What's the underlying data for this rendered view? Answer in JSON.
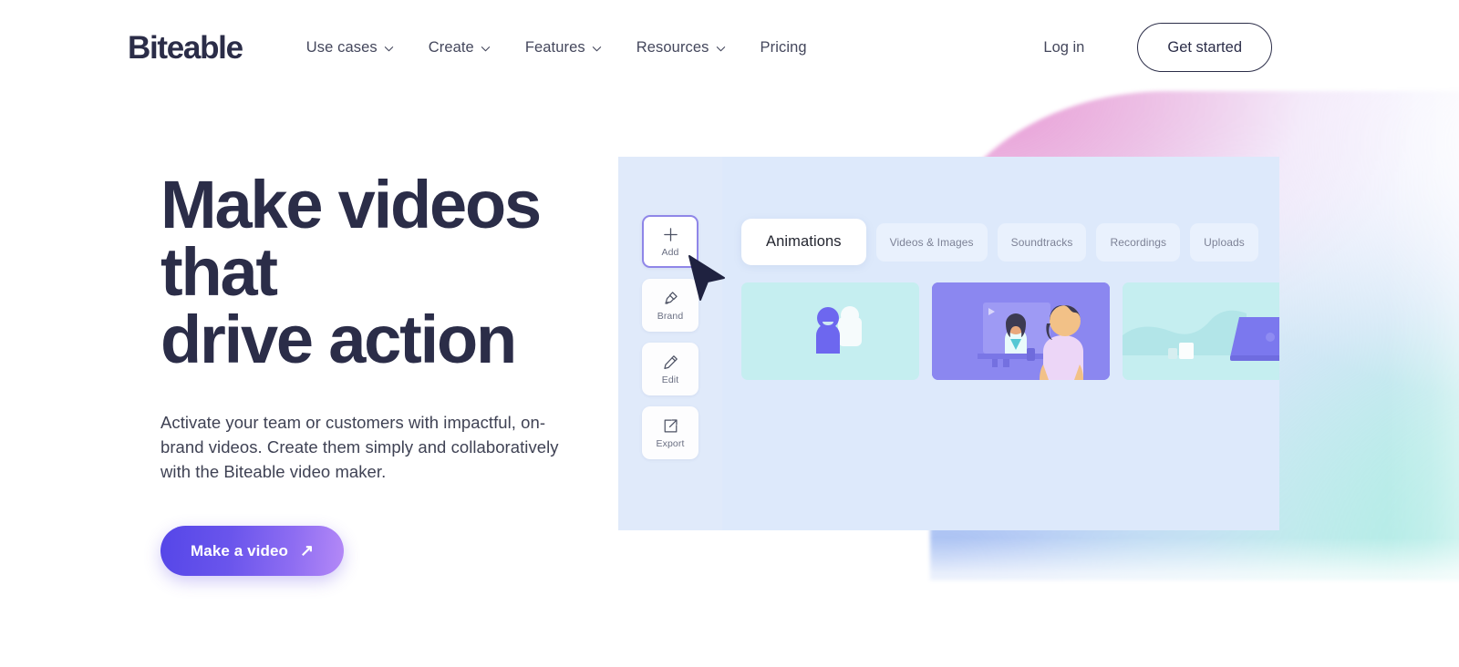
{
  "brand": {
    "logo_text": "Biteable",
    "accent_purple": "#5546e8",
    "accent_purple_light": "#b489f7",
    "text_dark": "#2b2d48"
  },
  "header": {
    "nav_items": [
      {
        "label": "Use cases",
        "has_chevron": true,
        "icon": "chevron-down-icon"
      },
      {
        "label": "Create",
        "has_chevron": true,
        "icon": "chevron-down-icon"
      },
      {
        "label": "Features",
        "has_chevron": true,
        "icon": "chevron-down-icon"
      },
      {
        "label": "Resources",
        "has_chevron": true,
        "icon": "chevron-down-icon"
      },
      {
        "label": "Pricing",
        "has_chevron": false,
        "icon": ""
      }
    ],
    "login_label": "Log in",
    "get_started_label": "Get started"
  },
  "hero": {
    "title": "Make videos that\ndrive action",
    "subtitle": "Activate your team or customers with impactful, on-brand videos. Create them simply and collaboratively with the Biteable video maker.",
    "cta_label": "Make a video",
    "cta_arrow": "↗"
  },
  "app_mock": {
    "sidebar_items": [
      {
        "label": "Add",
        "icon": "plus-icon",
        "active": true
      },
      {
        "label": "Brand",
        "icon": "paint-roller-icon",
        "active": false
      },
      {
        "label": "Edit",
        "icon": "pencil-icon",
        "active": false
      },
      {
        "label": "Export",
        "icon": "share-export-icon",
        "active": false
      }
    ],
    "tabs": [
      {
        "label": "Animations",
        "active": true
      },
      {
        "label": "Videos & Images",
        "active": false
      },
      {
        "label": "Soundtracks",
        "active": false
      },
      {
        "label": "Recordings",
        "active": false
      },
      {
        "label": "Uploads",
        "active": false
      }
    ],
    "media_cards": [
      {
        "name": "two-people-avatars-thumbnail",
        "style": "teal"
      },
      {
        "name": "video-call-illustration-thumbnail",
        "style": "purple"
      },
      {
        "name": "laptop-desk-illustration-thumbnail",
        "style": "teal"
      }
    ],
    "cursor_icon": "mouse-pointer-icon"
  }
}
